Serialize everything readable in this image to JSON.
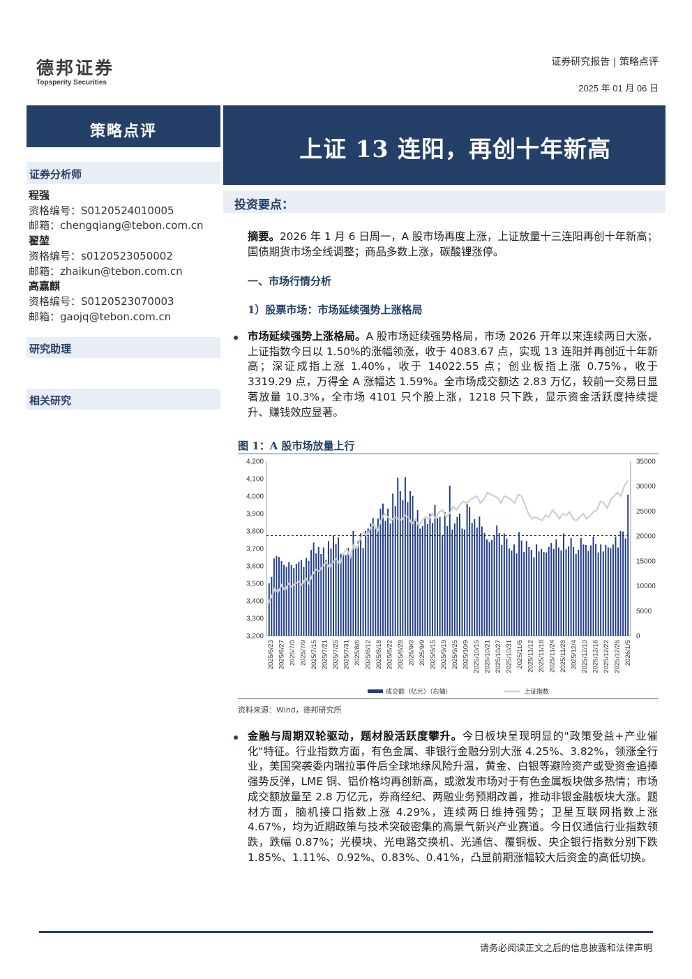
{
  "header": {
    "logo_cn": "德邦证券",
    "logo_en": "Topsperity Securities",
    "report_type": "证券研究报告 | 策略点评",
    "date": "2025 年 01 月 06 日"
  },
  "sidebar": {
    "category": "策略点评",
    "analysts_heading": "证券分析师",
    "analysts": [
      {
        "name": "程强",
        "cert": "资格编号：S0120524010005",
        "email": "邮箱：chengqiang@tebon.com.cn"
      },
      {
        "name": "翟堃",
        "cert": "资格编号：s0120523050002",
        "email": "邮箱：zhaikun@tebon.com.cn"
      },
      {
        "name": "高嘉麒",
        "cert": "资格编号：S0120523070003",
        "email": "邮箱：gaojq@tebon.com.cn"
      }
    ],
    "assistant_heading": "研究助理",
    "related_heading": "相关研究"
  },
  "main": {
    "title": "上证 13 连阳，再创十年新高",
    "key_points_heading": "投资要点：",
    "summary_label": "摘要。",
    "summary_text": "2026 年 1 月 6 日周一，A 股市场再度上涨，上证放量十三连阳再创十年新高；国债期货市场全线调整；商品多数上涨，碳酸锂涨停。",
    "section1": "一、市场行情分析",
    "subsection1": "1）股票市场：市场延续强势上涨格局",
    "bullet1_label": "市场延续强势上涨格局。",
    "bullet1_text": "A 股市场延续强势格局，市场 2026 开年以来连续两日大涨，上证指数今日以 1.50%的涨幅领涨，收于 4083.67 点，实现 13 连阳并再创近十年新高；深证成指上涨 1.40%，收于 14022.55 点；创业板指上涨 0.75%，收于 3319.29 点，万得全 A 涨幅达 1.59%。全市场成交额达 2.83 万亿，较前一交易日显著放量 10.3%，全市场 4101 只个股上涨，1218 只下跌，显示资金活跃度持续提升、赚钱效应显著。",
    "figure_title": "图 1：A 股市场放量上行",
    "figure_source": "资料来源：Wind，德邦研究所",
    "bullet2_label": "金融与周期双轮驱动，题材股活跃度攀升。",
    "bullet2_text": "今日板块呈现明显的\"政策受益+产业催化\"特征。行业指数方面，有色金属、非银行金融分别大涨 4.25%、3.82%，领涨全行业，美国突袭委内瑞拉事件后全球地缘风险升温，黄金、白银等避险资产或受资金追捧强势反弹，LME 铜、铝价格均再创新高，或激发市场对于有色金属板块做多热情；市场成交额放量至 2.8 万亿元，券商经纪、两融业务预期改善，推动非银金融板块大涨。题材方面，脑机接口指数上涨 4.29%，连续两日维持强势；卫星互联网指数上涨 4.67%，均为近期政策与技术突破密集的高景气新兴产业赛道。今日仅通信行业指数领跌，跌幅 0.87%；光模块、光电路交换机、光通信、覆铜板、央企银行指数分别下跌 1.85%、1.11%、0.92%、0.83%、0.41%，凸显前期涨幅较大后资金的高低切换。"
  },
  "footer": {
    "disclaimer": "请务必阅读正文之后的信息披露和法律声明"
  },
  "colors": {
    "brand": "#243f68",
    "bar": "#1f3c88",
    "line": "#cfcfcf"
  },
  "chart_data": {
    "type": "bar+line",
    "title": "",
    "left_axis": {
      "ylim": [
        3200,
        4200
      ],
      "ticks": [
        "3,200",
        "3,300",
        "3,400",
        "3,500",
        "3,600",
        "3,700",
        "3,800",
        "3,900",
        "4,000",
        "4,100",
        "4,200"
      ]
    },
    "right_axis": {
      "ylim": [
        0,
        35000
      ],
      "ticks": [
        "0",
        "5000",
        "10000",
        "15000",
        "20000",
        "25000",
        "30000",
        "35000"
      ]
    },
    "x_tick_labels": [
      "2025/6/23",
      "2025/6/27",
      "2025/7/3",
      "2025/7/9",
      "2025/7/15",
      "2025/7/21",
      "2025/7/25",
      "2025/7/31",
      "2025/8/6",
      "2025/8/12",
      "2025/8/18",
      "2025/8/22",
      "2025/8/28",
      "2025/9/3",
      "2025/9/9",
      "2025/9/15",
      "2025/9/19",
      "2025/9/25",
      "2025/10/9",
      "2025/10/15",
      "2025/10/21",
      "2025/10/27",
      "2025/10/31",
      "2025/11/6",
      "2025/11/12",
      "2025/11/18",
      "2025/11/24",
      "2025/11/28",
      "2025/12/4",
      "2025/12/10",
      "2025/12/16",
      "2025/12/22",
      "2025/12/26",
      "2026/1/5"
    ],
    "series": [
      {
        "name": "成交额（亿元）（右轴）",
        "axis": "right",
        "values": [
          10500,
          11800,
          15500,
          16000,
          15800,
          15000,
          14200,
          13800,
          14800,
          14200,
          13600,
          14400,
          14800,
          15200,
          13800,
          15600,
          15000,
          17200,
          18700,
          16500,
          17800,
          16400,
          17700,
          15200,
          19000,
          17500,
          20100,
          18400,
          19700,
          16400,
          16400,
          16200,
          17600,
          16300,
          21000,
          17500,
          19000,
          20500,
          17600,
          21000,
          21500,
          22500,
          23600,
          21500,
          23500,
          25500,
          26500,
          23000,
          25500,
          22500,
          28500,
          26000,
          31700,
          29000,
          27200,
          31800,
          26800,
          29000,
          28000,
          23000,
          25200,
          21500,
          22000,
          23500,
          22400,
          24500,
          22600,
          26200,
          23500,
          23800,
          20200,
          24800,
          22000,
          30100,
          21300,
          22500,
          23800,
          24500,
          21500,
          21300,
          26400,
          25800,
          22600,
          23400,
          21700,
          23900,
          21900,
          20600,
          19300,
          18800,
          19200,
          20200,
          22100,
          20600,
          18200,
          20500,
          19500,
          17500,
          17100,
          18300,
          16500,
          20800,
          19100,
          16800,
          19000,
          17800,
          17200,
          15700,
          18300,
          16900,
          17400,
          16800,
          16700,
          17800,
          18600,
          17400,
          19300,
          17700,
          17100,
          20500,
          17300,
          17900,
          19600,
          17800,
          16400,
          17200,
          19600,
          18300,
          18200,
          17000,
          18100,
          19900,
          18400,
          16700,
          18300,
          16900,
          18200,
          17700,
          17600,
          18300,
          19900,
          17700,
          21000,
          20900,
          19500,
          28300
        ]
      },
      {
        "name": "上证指数",
        "axis": "left",
        "values": [
          3380,
          3420,
          3470,
          3450,
          3490,
          3460,
          3500,
          3480,
          3500,
          3510,
          3490,
          3530,
          3500,
          3550,
          3580,
          3570,
          3600,
          3620,
          3590,
          3620,
          3640,
          3610,
          3670,
          3700,
          3650,
          3720,
          3700,
          3760,
          3790,
          3770,
          3820,
          3840,
          3800,
          3860,
          3900,
          3880,
          3860,
          3880,
          3870,
          3860,
          3890,
          3880,
          3840,
          3870,
          3830,
          3860,
          3880,
          3870,
          3900,
          3870,
          3910,
          3920,
          3880,
          3900,
          3940,
          3920,
          3950,
          3970,
          3960,
          3980,
          3990,
          4000,
          3960,
          3980,
          4020,
          4010,
          4000,
          3990,
          3960,
          4000,
          3990,
          3980,
          3960,
          4010,
          4000,
          3950,
          3900,
          3870,
          3880,
          3870,
          3860,
          3890,
          3880,
          3920,
          3900,
          3870,
          3900,
          3890,
          3910,
          3870,
          3860,
          3880,
          3900,
          3870,
          3890,
          3910,
          3920,
          3970,
          3960,
          3930,
          3980,
          4000,
          4020,
          4000,
          4060,
          4090
        ]
      }
    ],
    "reference_line": {
      "axis": "left",
      "value": 3774
    },
    "legend": [
      "成交额（亿元）（右轴）",
      "上证指数"
    ],
    "legend_position": "bottom",
    "grid": false
  }
}
